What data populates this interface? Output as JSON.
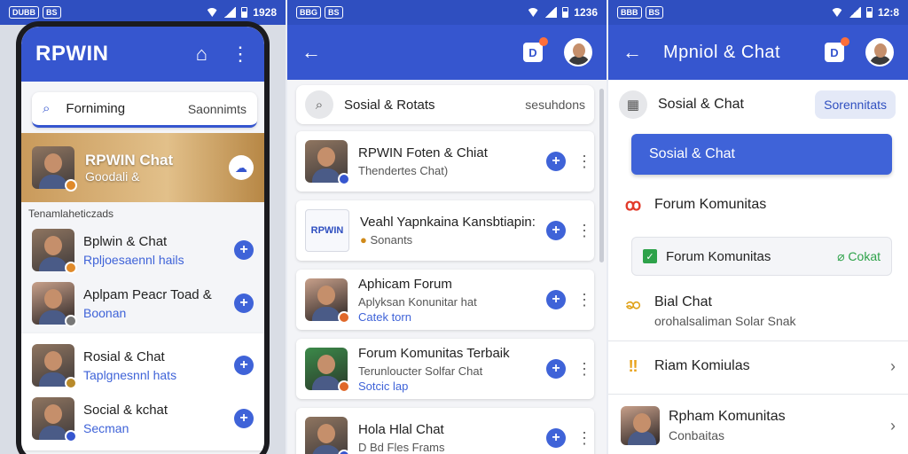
{
  "status": {
    "p1": {
      "pills": [
        "DUBB",
        "BS"
      ],
      "time": "1928"
    },
    "p2": {
      "pills": [
        "BBG",
        "BS"
      ],
      "time": "1236"
    },
    "p3": {
      "pills": [
        "BBB",
        "BS"
      ],
      "time": "12:8"
    }
  },
  "panel1": {
    "app_title": "RPWIN",
    "search": {
      "label": "Forniming",
      "hint": "Saonnimts"
    },
    "banner": {
      "title": "RPWIN Chat",
      "sub": "Goodali &"
    },
    "section_label": "Tenamlaheticzads",
    "rows": [
      {
        "title": "Bplwin & Chat",
        "sub": "Rpljoesaennl hails"
      },
      {
        "title": "Aplpam Peacr Toad &",
        "sub": "Boonan"
      },
      {
        "title": "Rosial & Chat",
        "sub": "Taplgnesnnl hats"
      },
      {
        "title": "Social & kchat",
        "sub": "Secman"
      }
    ]
  },
  "panel2": {
    "search": {
      "label": "Sosial & Rotats",
      "hint": "sesuhdons"
    },
    "cards": [
      {
        "title": "RPWIN Foten & Chiat",
        "sub": "Thendertes Chat)",
        "sub_blue": false,
        "logo": ""
      },
      {
        "title": "Veahl Yapnkaina Kansbtiapin:",
        "sub": "Sonants",
        "sub_blue": false,
        "logo": "RPWIN"
      },
      {
        "title": "Aphicam Forum",
        "sub": "Aplyksan Konunitar hat",
        "sub2": "Catek torn",
        "sub_blue": true,
        "logo": ""
      },
      {
        "title": "Forum Komunitas Terbaik",
        "sub": "Terunloucter Solfar Chat",
        "sub2": "Sotcic lap",
        "sub_blue": true,
        "logo": ""
      },
      {
        "title": "Hola Hlal Chat",
        "sub": "D Bd Fles Frams",
        "sub_blue": false,
        "logo": ""
      }
    ]
  },
  "panel3": {
    "app_title": "Mpniol & Chat",
    "search": {
      "label": "Sosial & Chat",
      "chip": "Sorennitats"
    },
    "selected": "Sosial & Chat",
    "forum1": "Forum Komunitas",
    "forum_box": {
      "label": "Forum Komunitas",
      "action": "Cokat"
    },
    "bial": {
      "title": "Bial Chat",
      "sub": "orohalsaliman Solar Snak"
    },
    "riam": "Riam Komiulas",
    "rpham": {
      "title": "Rpham Komunitas",
      "sub": "Conbaitas"
    }
  },
  "colors": {
    "primary": "#3656cf",
    "accent_blue": "#3f63d8",
    "green": "#2ea24a",
    "badge": "#ff6f3a"
  }
}
